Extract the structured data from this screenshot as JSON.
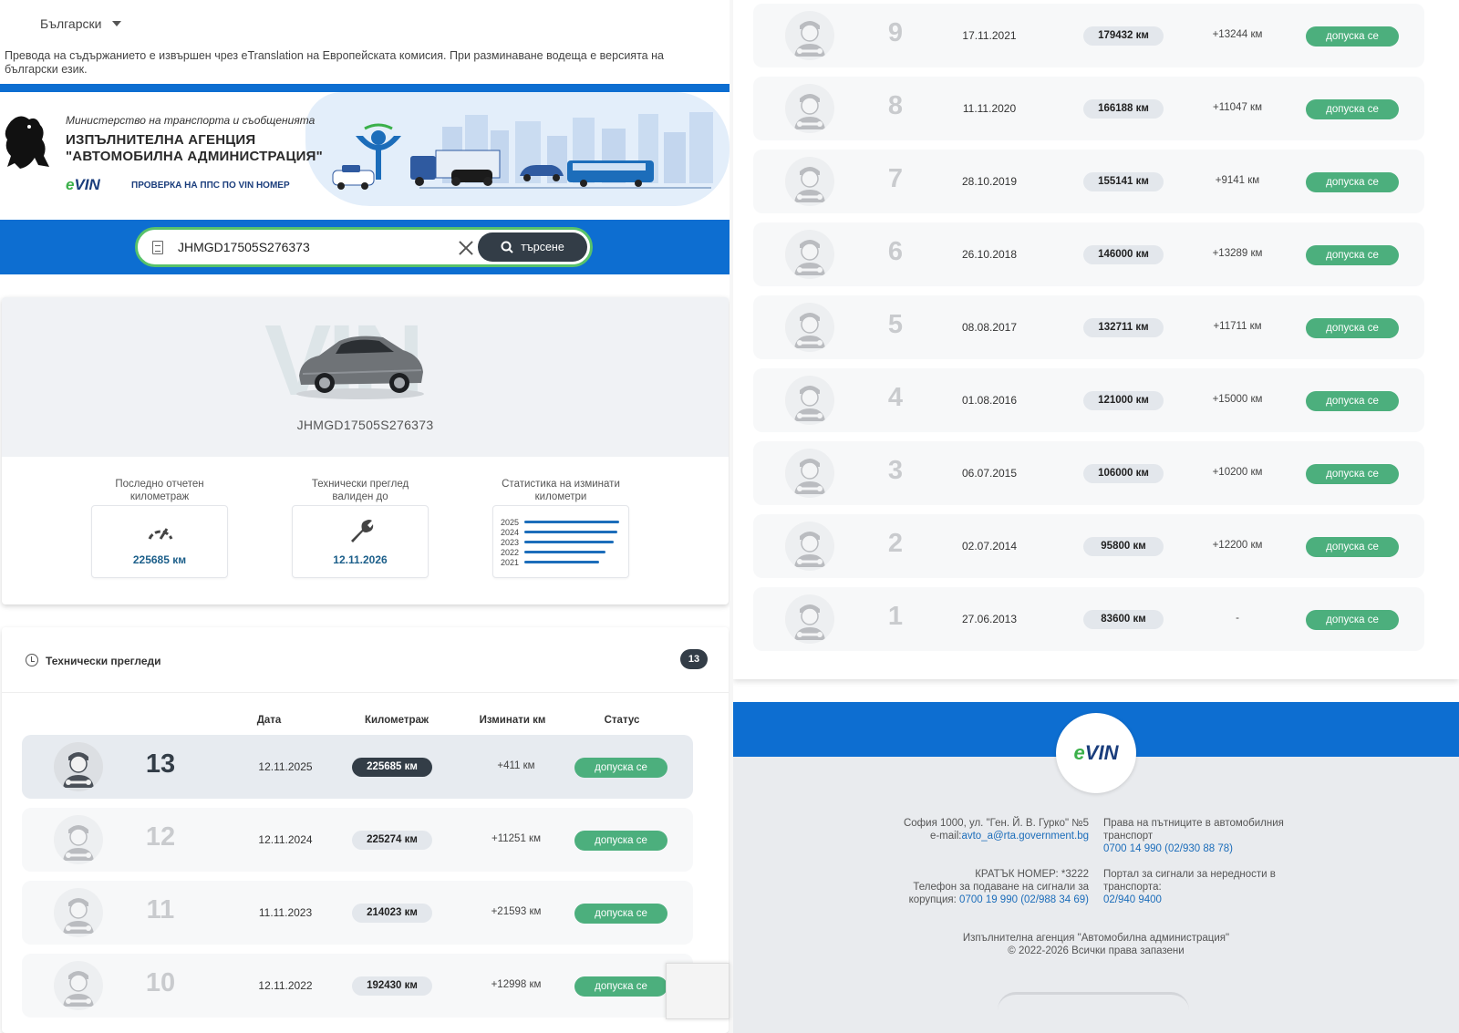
{
  "language": {
    "selected": "Български"
  },
  "translation_notice": "Превода на съдържанието е извършен чрез eTranslation на Европейската комисия. При разминаване водеща е версията на български език.",
  "header": {
    "ministry": "Министерство на транспорта и съобщенията",
    "agency_line1": "ИЗПЪЛНИТЕЛНА АГЕНЦИЯ",
    "agency_line2": "\"АВТОМОБИЛНА АДМИНИСТРАЦИЯ\"",
    "evin_logo": "eVIN",
    "vin_check": "ПРОВЕРКА НА ППС ПО VIN НОМЕР"
  },
  "search": {
    "value": "JHMGD17505S276373",
    "button_label": "търсене"
  },
  "vehicle": {
    "watermark": "VIN",
    "vin": "JHMGD17505S276373",
    "stats": {
      "odometer_label": "Последно отчетен километраж",
      "odometer_value": "225685 км",
      "inspection_label": "Технически преглед валиден до",
      "inspection_value": "12.11.2026",
      "mileage_stats_label": "Статистика на изминати километри",
      "mini_chart": [
        {
          "year": "2025",
          "fraction": 1.0
        },
        {
          "year": "2024",
          "fraction": 0.98
        },
        {
          "year": "2023",
          "fraction": 0.94
        },
        {
          "year": "2022",
          "fraction": 0.86
        },
        {
          "year": "2021",
          "fraction": 0.79
        }
      ]
    }
  },
  "inspections": {
    "title": "Технически прегледи",
    "count": "13",
    "columns": {
      "date": "Дата",
      "odometer": "Километраж",
      "distance": "Изминати км",
      "status": "Статус"
    },
    "records": [
      {
        "num": "13",
        "date": "12.11.2025",
        "km": "225685 км",
        "diff": "+411 км",
        "status": "допуска се"
      },
      {
        "num": "12",
        "date": "12.11.2024",
        "km": "225274 км",
        "diff": "+11251 км",
        "status": "допуска се"
      },
      {
        "num": "11",
        "date": "11.11.2023",
        "km": "214023 км",
        "diff": "+21593 км",
        "status": "допуска се"
      },
      {
        "num": "10",
        "date": "12.11.2022",
        "km": "192430 км",
        "diff": "+12998 км",
        "status": "допуска се"
      },
      {
        "num": "9",
        "date": "17.11.2021",
        "km": "179432 км",
        "diff": "+13244 км",
        "status": "допуска се"
      },
      {
        "num": "8",
        "date": "11.11.2020",
        "km": "166188 км",
        "diff": "+11047 км",
        "status": "допуска се"
      },
      {
        "num": "7",
        "date": "28.10.2019",
        "km": "155141 км",
        "diff": "+9141 км",
        "status": "допуска се"
      },
      {
        "num": "6",
        "date": "26.10.2018",
        "km": "146000 км",
        "diff": "+13289 км",
        "status": "допуска се"
      },
      {
        "num": "5",
        "date": "08.08.2017",
        "km": "132711 км",
        "diff": "+11711 км",
        "status": "допуска се"
      },
      {
        "num": "4",
        "date": "01.08.2016",
        "km": "121000 км",
        "diff": "+15000 км",
        "status": "допуска се"
      },
      {
        "num": "3",
        "date": "06.07.2015",
        "km": "106000 км",
        "diff": "+10200 км",
        "status": "допуска се"
      },
      {
        "num": "2",
        "date": "02.07.2014",
        "km": "95800 км",
        "diff": "+12200 км",
        "status": "допуска се"
      },
      {
        "num": "1",
        "date": "27.06.2013",
        "km": "83600 км",
        "diff": "-",
        "status": "допуска се"
      }
    ]
  },
  "footer": {
    "logo": "eVIN",
    "address": "София 1000, ул. \"Ген. Й. В. Гурко\" №5",
    "email_label": "e-mail:",
    "email": "avto_a@rta.government.bg",
    "rights_line1": "Права на пътниците в автомобилния",
    "rights_line2": "транспорт",
    "rights_phone": "0700 14 990 (02/930 88 78)",
    "short_number": "КРАТЪК НОМЕР: *3222",
    "corruption_line1": "Телефон за подаване на сигнали за",
    "corruption_line2": "корупция:",
    "corruption_phone": "0700 19 990 (02/988 34 69)",
    "portal_line1": "Портал за сигнали за нередности в",
    "portal_line2": "транспорта:",
    "portal_phone": "02/940 9400",
    "agency": "Изпълнителна агенция \"Автомобилна администрация\"",
    "copyright": "© 2022-2026 Всички права запазени"
  }
}
